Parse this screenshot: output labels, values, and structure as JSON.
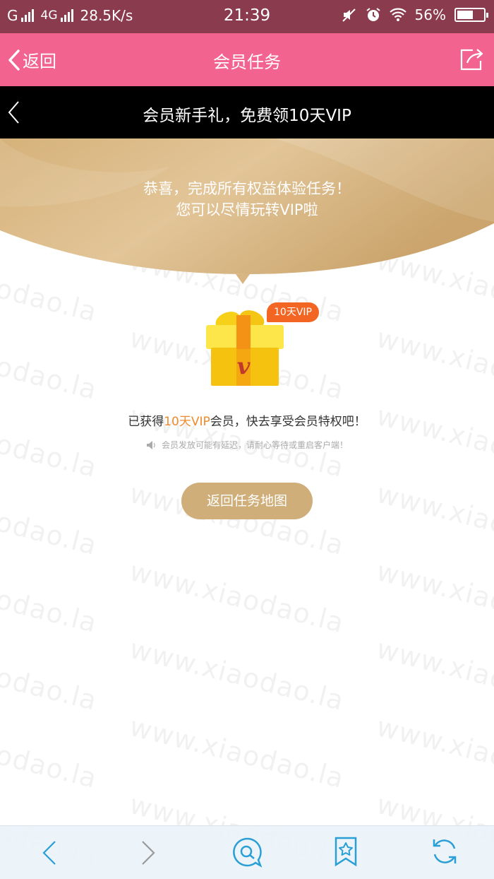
{
  "status_bar": {
    "carrier": "G",
    "network": "4G",
    "speed": "28.5K/s",
    "time": "21:39",
    "battery": "56%"
  },
  "header": {
    "back_label": "返回",
    "title": "会员任务"
  },
  "sub_header": {
    "title": "会员新手礼，免费领10天VIP"
  },
  "banner": {
    "line1": "恭喜，完成所有权益体验任务！",
    "line2": "您可以尽情玩转VIP啦"
  },
  "gift": {
    "badge": "10天VIP",
    "letter": "v"
  },
  "obtained": {
    "prefix": "已获得",
    "highlight": "10天VIP",
    "suffix": "会员，快去享受会员特权吧！"
  },
  "notice": "会员发放可能有延迟，请耐心等待或重启客户端！",
  "return_button": "返回任务地图",
  "watermark": "www.xiaodao.la",
  "colors": {
    "status_bar": "#8a3b4e",
    "header": "#f2648f",
    "gold": "#cfae79",
    "badge": "#f26522",
    "highlight": "#f08a2d",
    "bottom_icon": "#2a9fd6"
  },
  "bottom_bar": {
    "icons": [
      "back-arrow-icon",
      "forward-arrow-icon",
      "search-chat-icon",
      "bookmark-star-icon",
      "refresh-icon"
    ]
  }
}
